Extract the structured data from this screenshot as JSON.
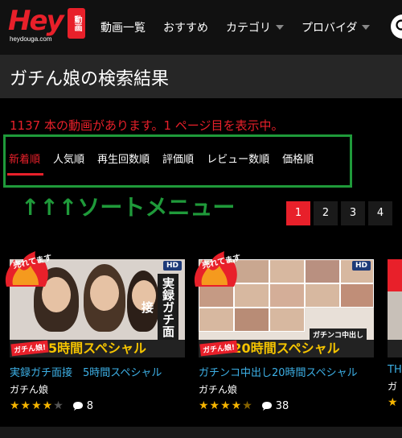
{
  "brand": {
    "logo_text": "Hey",
    "logo_badge": "動画",
    "logo_sub": "heydouga.com"
  },
  "nav": {
    "items": [
      {
        "label": "動画一覧",
        "has_caret": false
      },
      {
        "label": "おすすめ",
        "has_caret": false
      },
      {
        "label": "カテゴリ",
        "has_caret": true
      },
      {
        "label": "プロバイダ",
        "has_caret": true
      }
    ]
  },
  "page_title": "ガチん娘の検索結果",
  "result_text": "1137 本の動画があります。1 ページ目を表示中。",
  "sort": {
    "items": [
      "新着順",
      "人気順",
      "再生回数順",
      "評価順",
      "レビュー数順",
      "価格順"
    ],
    "active": "新着順",
    "note": "↑↑↑ソートメニュー"
  },
  "pager": {
    "pages": [
      "1",
      "2",
      "3",
      "4"
    ],
    "active": "1"
  },
  "cards": [
    {
      "title": "実録ガチ面接　5時間スペシャル",
      "maker": "ガチん娘",
      "rating": 4,
      "comments": "8",
      "hot_label": "売れてます",
      "hd": "HD",
      "banner": "5時間スペシャル",
      "side_text": "実録ガチ面接",
      "tag": "ガチん娘!"
    },
    {
      "title": "ガチンコ中出し20時間スペシャル",
      "maker": "ガチん娘",
      "rating": 4.5,
      "comments": "38",
      "hot_label": "売れてます",
      "hd": "HD",
      "banner": "20時間スペシャル",
      "side_text": "",
      "tag": "ガチん娘!",
      "sub_banner": "ガチンコ中出し"
    },
    {
      "title": "TH",
      "maker": "ガ",
      "rating": 0,
      "comments": "",
      "hot_label": "売れてます"
    }
  ],
  "colors": {
    "accent": "#e8202a",
    "link": "#3db0e6",
    "note_green": "#1f9a3a",
    "star": "#f5b400"
  }
}
